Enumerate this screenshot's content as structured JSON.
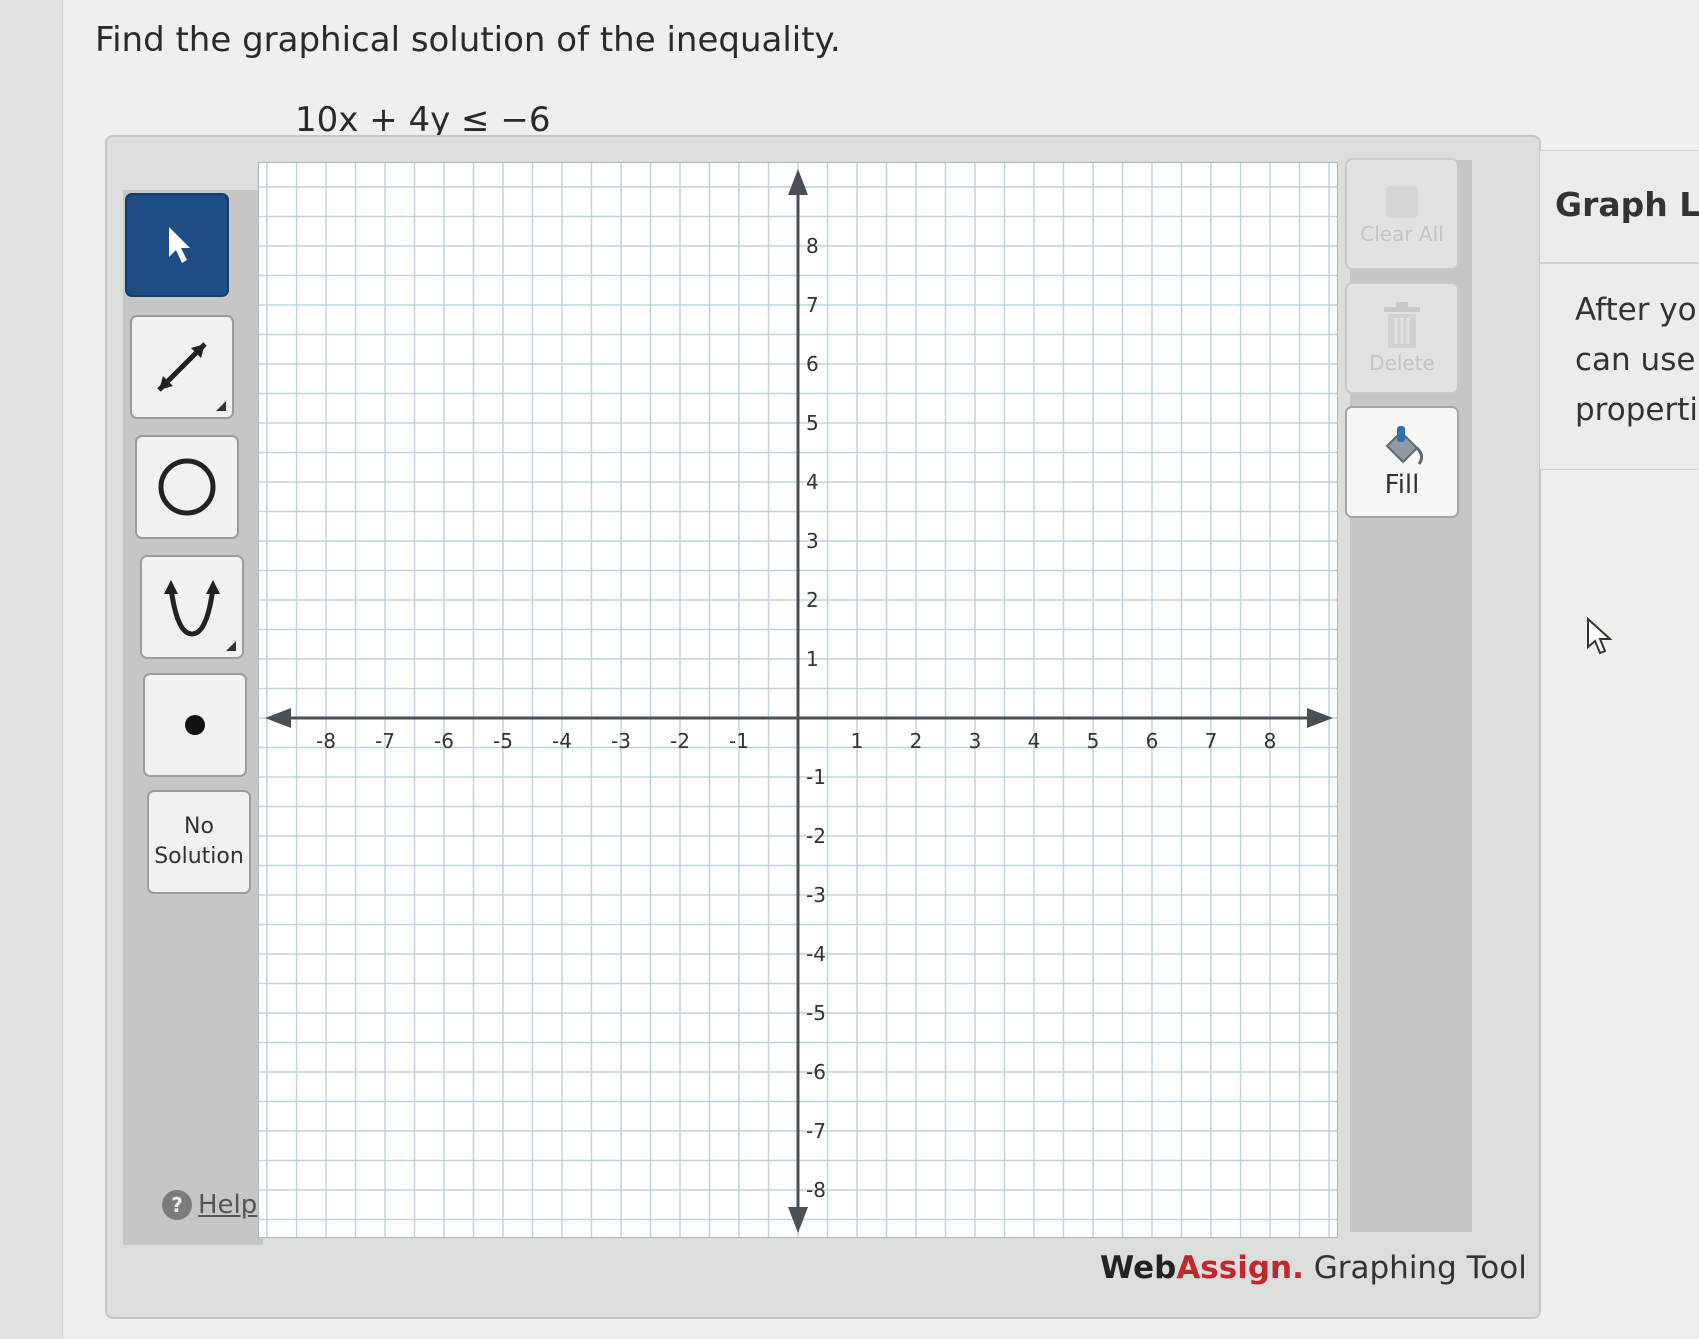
{
  "question": "Find the graphical solution of the inequality.",
  "equation": "10x + 4y ≤ −6",
  "toolbar": {
    "select_icon": "arrow-pointer-icon",
    "line_icon": "line-icon",
    "circle_icon": "circle-icon",
    "parabola_icon": "parabola-icon",
    "point_icon": "point-icon",
    "no_solution_line1": "No",
    "no_solution_line2": "Solution",
    "help_label": "Help"
  },
  "actions": {
    "clear_all_label": "Clear All",
    "delete_label": "Delete",
    "fill_label": "Fill"
  },
  "graph": {
    "x_ticks": [
      "-8",
      "-7",
      "-6",
      "-5",
      "-4",
      "-3",
      "-2",
      "-1",
      "1",
      "2",
      "3",
      "4",
      "5",
      "6",
      "7",
      "8"
    ],
    "y_ticks": [
      "8",
      "7",
      "6",
      "5",
      "4",
      "3",
      "2",
      "1",
      "-1",
      "-2",
      "-3",
      "-4",
      "-5",
      "-6",
      "-7",
      "-8"
    ]
  },
  "footer": {
    "web": "Web",
    "assign": "Assign.",
    "rest": " Graphing Tool"
  },
  "side_panel": {
    "title": "Graph La",
    "lines": [
      "After you",
      "can use",
      "propertie"
    ]
  },
  "colors": {
    "active_tool": "#1c4d84",
    "grid": "#bfd3df",
    "brand_red": "#c2272d"
  }
}
